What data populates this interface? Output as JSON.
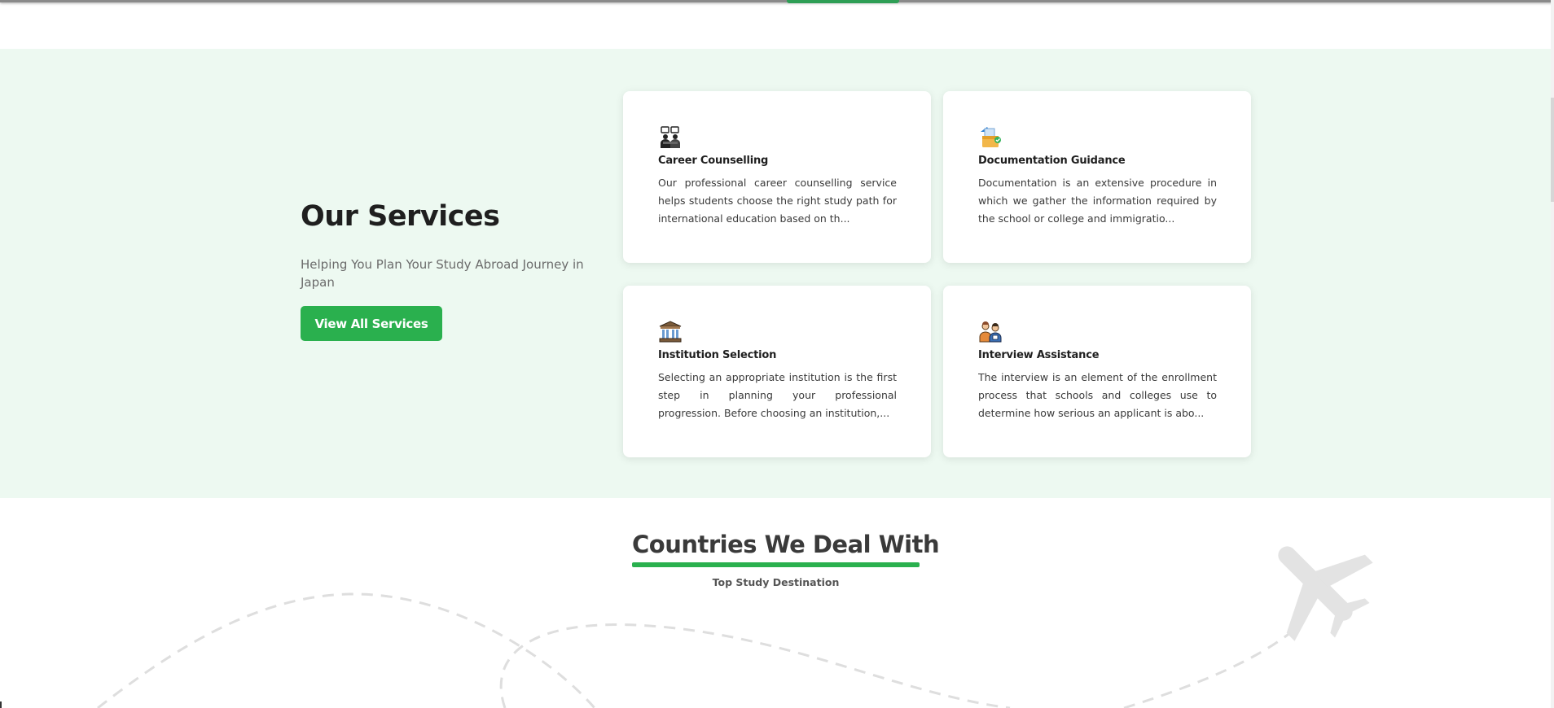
{
  "services": {
    "title": "Our Services",
    "subtitle": "Helping You Plan Your Study Abroad Journey in Japan",
    "view_all_label": "View All Services",
    "cards": [
      {
        "icon": "counselling-icon",
        "title": "Career Counselling",
        "description": "Our professional career counselling service helps students choose the right study path for international education based on th..."
      },
      {
        "icon": "documentation-icon",
        "title": "Documentation Guidance",
        "description": "Documentation is an extensive procedure in which we gather the information required by the school or college and immigratio..."
      },
      {
        "icon": "institution-icon",
        "title": "Institution Selection",
        "description": "Selecting an appropriate institution is the first step in planning your professional progression. Before choosing an institution,..."
      },
      {
        "icon": "interview-icon",
        "title": "Interview Assistance",
        "description": "The interview is an element of the enrollment process that schools and colleges use to determine how serious an applicant is abo..."
      }
    ]
  },
  "countries": {
    "title": "Countries We Deal With",
    "subtitle": "Top Study Destination"
  },
  "colors": {
    "accent": "#2ab04e",
    "section_bg": "#edf9f1",
    "heading": "#1f1f1f"
  }
}
